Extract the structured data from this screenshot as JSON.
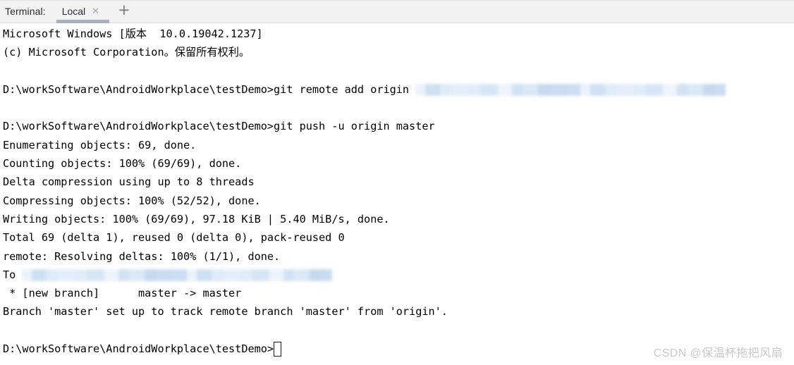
{
  "tab_bar": {
    "terminal_label": "Terminal:",
    "tabs": [
      {
        "label": "Local",
        "close_icon": "close-icon",
        "active": true
      }
    ],
    "add_tab_icon": "+",
    "active_underline_color": "#a7afc0",
    "background_color": "#f2f2f2"
  },
  "terminal": {
    "background_color": "#ffffff",
    "text_color": "#000000",
    "prompt_path": "D:\\workSoftware\\AndroidWorkplace\\testDemo>",
    "cursor": "block-cursor-hollow",
    "redaction_color": "#cfe0f2",
    "lines": [
      {
        "id": "l1",
        "text": "Microsoft Windows [版本  10.0.19042.1237]"
      },
      {
        "id": "l2",
        "text": "(c) Microsoft Corporation。保留所有权利。"
      },
      {
        "id": "l3",
        "text": ""
      },
      {
        "id": "l4",
        "text": "D:\\workSoftware\\AndroidWorkplace\\testDemo>git remote add origin ",
        "redaction_width": 440
      },
      {
        "id": "l5",
        "text": ""
      },
      {
        "id": "l6",
        "text": "D:\\workSoftware\\AndroidWorkplace\\testDemo>git push -u origin master"
      },
      {
        "id": "l7",
        "text": "Enumerating objects: 69, done."
      },
      {
        "id": "l8",
        "text": "Counting objects: 100% (69/69), done."
      },
      {
        "id": "l9",
        "text": "Delta compression using up to 8 threads"
      },
      {
        "id": "l10",
        "text": "Compressing objects: 100% (52/52), done."
      },
      {
        "id": "l11",
        "text": "Writing objects: 100% (69/69), 97.18 KiB | 5.40 MiB/s, done."
      },
      {
        "id": "l12",
        "text": "Total 69 (delta 1), reused 0 (delta 0), pack-reused 0"
      },
      {
        "id": "l13",
        "text": "remote: Resolving deltas: 100% (1/1), done."
      },
      {
        "id": "l14",
        "text": "To ",
        "redaction_width": 440
      },
      {
        "id": "l15",
        "text": " * [new branch]      master -> master"
      },
      {
        "id": "l16",
        "text": "Branch 'master' set up to track remote branch 'master' from 'origin'."
      },
      {
        "id": "l17",
        "text": ""
      },
      {
        "id": "l18",
        "text": "D:\\workSoftware\\AndroidWorkplace\\testDemo>",
        "cursor": true
      }
    ]
  },
  "watermark": {
    "text": "CSDN @保温杯拖把风扇"
  }
}
